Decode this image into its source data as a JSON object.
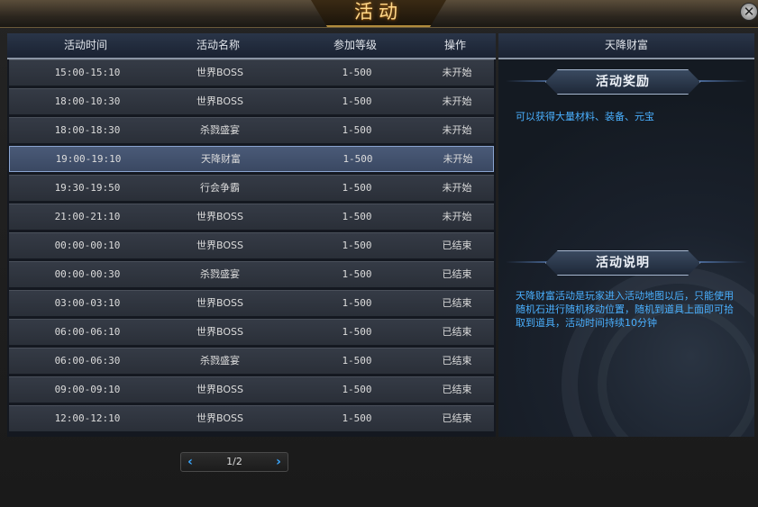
{
  "window": {
    "title": "活动",
    "close_label": "✕"
  },
  "table": {
    "headers": [
      "活动时间",
      "活动名称",
      "参加等级",
      "操作"
    ],
    "rows": [
      {
        "time": "15:00-15:10",
        "name": "世界BOSS",
        "level": "1-500",
        "status": "未开始"
      },
      {
        "time": "18:00-10:30",
        "name": "世界BOSS",
        "level": "1-500",
        "status": "未开始"
      },
      {
        "time": "18:00-18:30",
        "name": "杀戮盛宴",
        "level": "1-500",
        "status": "未开始"
      },
      {
        "time": "19:00-19:10",
        "name": "天降财富",
        "level": "1-500",
        "status": "未开始"
      },
      {
        "time": "19:30-19:50",
        "name": "行会争霸",
        "level": "1-500",
        "status": "未开始"
      },
      {
        "time": "21:00-21:10",
        "name": "世界BOSS",
        "level": "1-500",
        "status": "未开始"
      },
      {
        "time": "00:00-00:10",
        "name": "世界BOSS",
        "level": "1-500",
        "status": "已结束"
      },
      {
        "time": "00:00-00:30",
        "name": "杀戮盛宴",
        "level": "1-500",
        "status": "已结束"
      },
      {
        "time": "03:00-03:10",
        "name": "世界BOSS",
        "level": "1-500",
        "status": "已结束"
      },
      {
        "time": "06:00-06:10",
        "name": "世界BOSS",
        "level": "1-500",
        "status": "已结束"
      },
      {
        "time": "06:00-06:30",
        "name": "杀戮盛宴",
        "level": "1-500",
        "status": "已结束"
      },
      {
        "time": "09:00-09:10",
        "name": "世界BOSS",
        "level": "1-500",
        "status": "已结束"
      },
      {
        "time": "12:00-12:10",
        "name": "世界BOSS",
        "level": "1-500",
        "status": "已结束"
      }
    ],
    "selected_row": 3
  },
  "pager": {
    "prev": "‹",
    "page": "1/2",
    "next": "›"
  },
  "panel": {
    "title": "天降财富",
    "reward_title": "活动奖励",
    "reward_text": "可以获得大量材料、装备、元宝",
    "desc_title": "活动说明",
    "desc_text": "天降财富活动是玩家进入活动地图以后，只能使用随机石进行随机移动位置，随机到道具上面即可拾取到道具，活动时间持续10分钟"
  },
  "colors": {
    "title_gold": "#ffd88a",
    "accent_blue": "#4ab0ff",
    "selected_row": "#4a5a78"
  }
}
